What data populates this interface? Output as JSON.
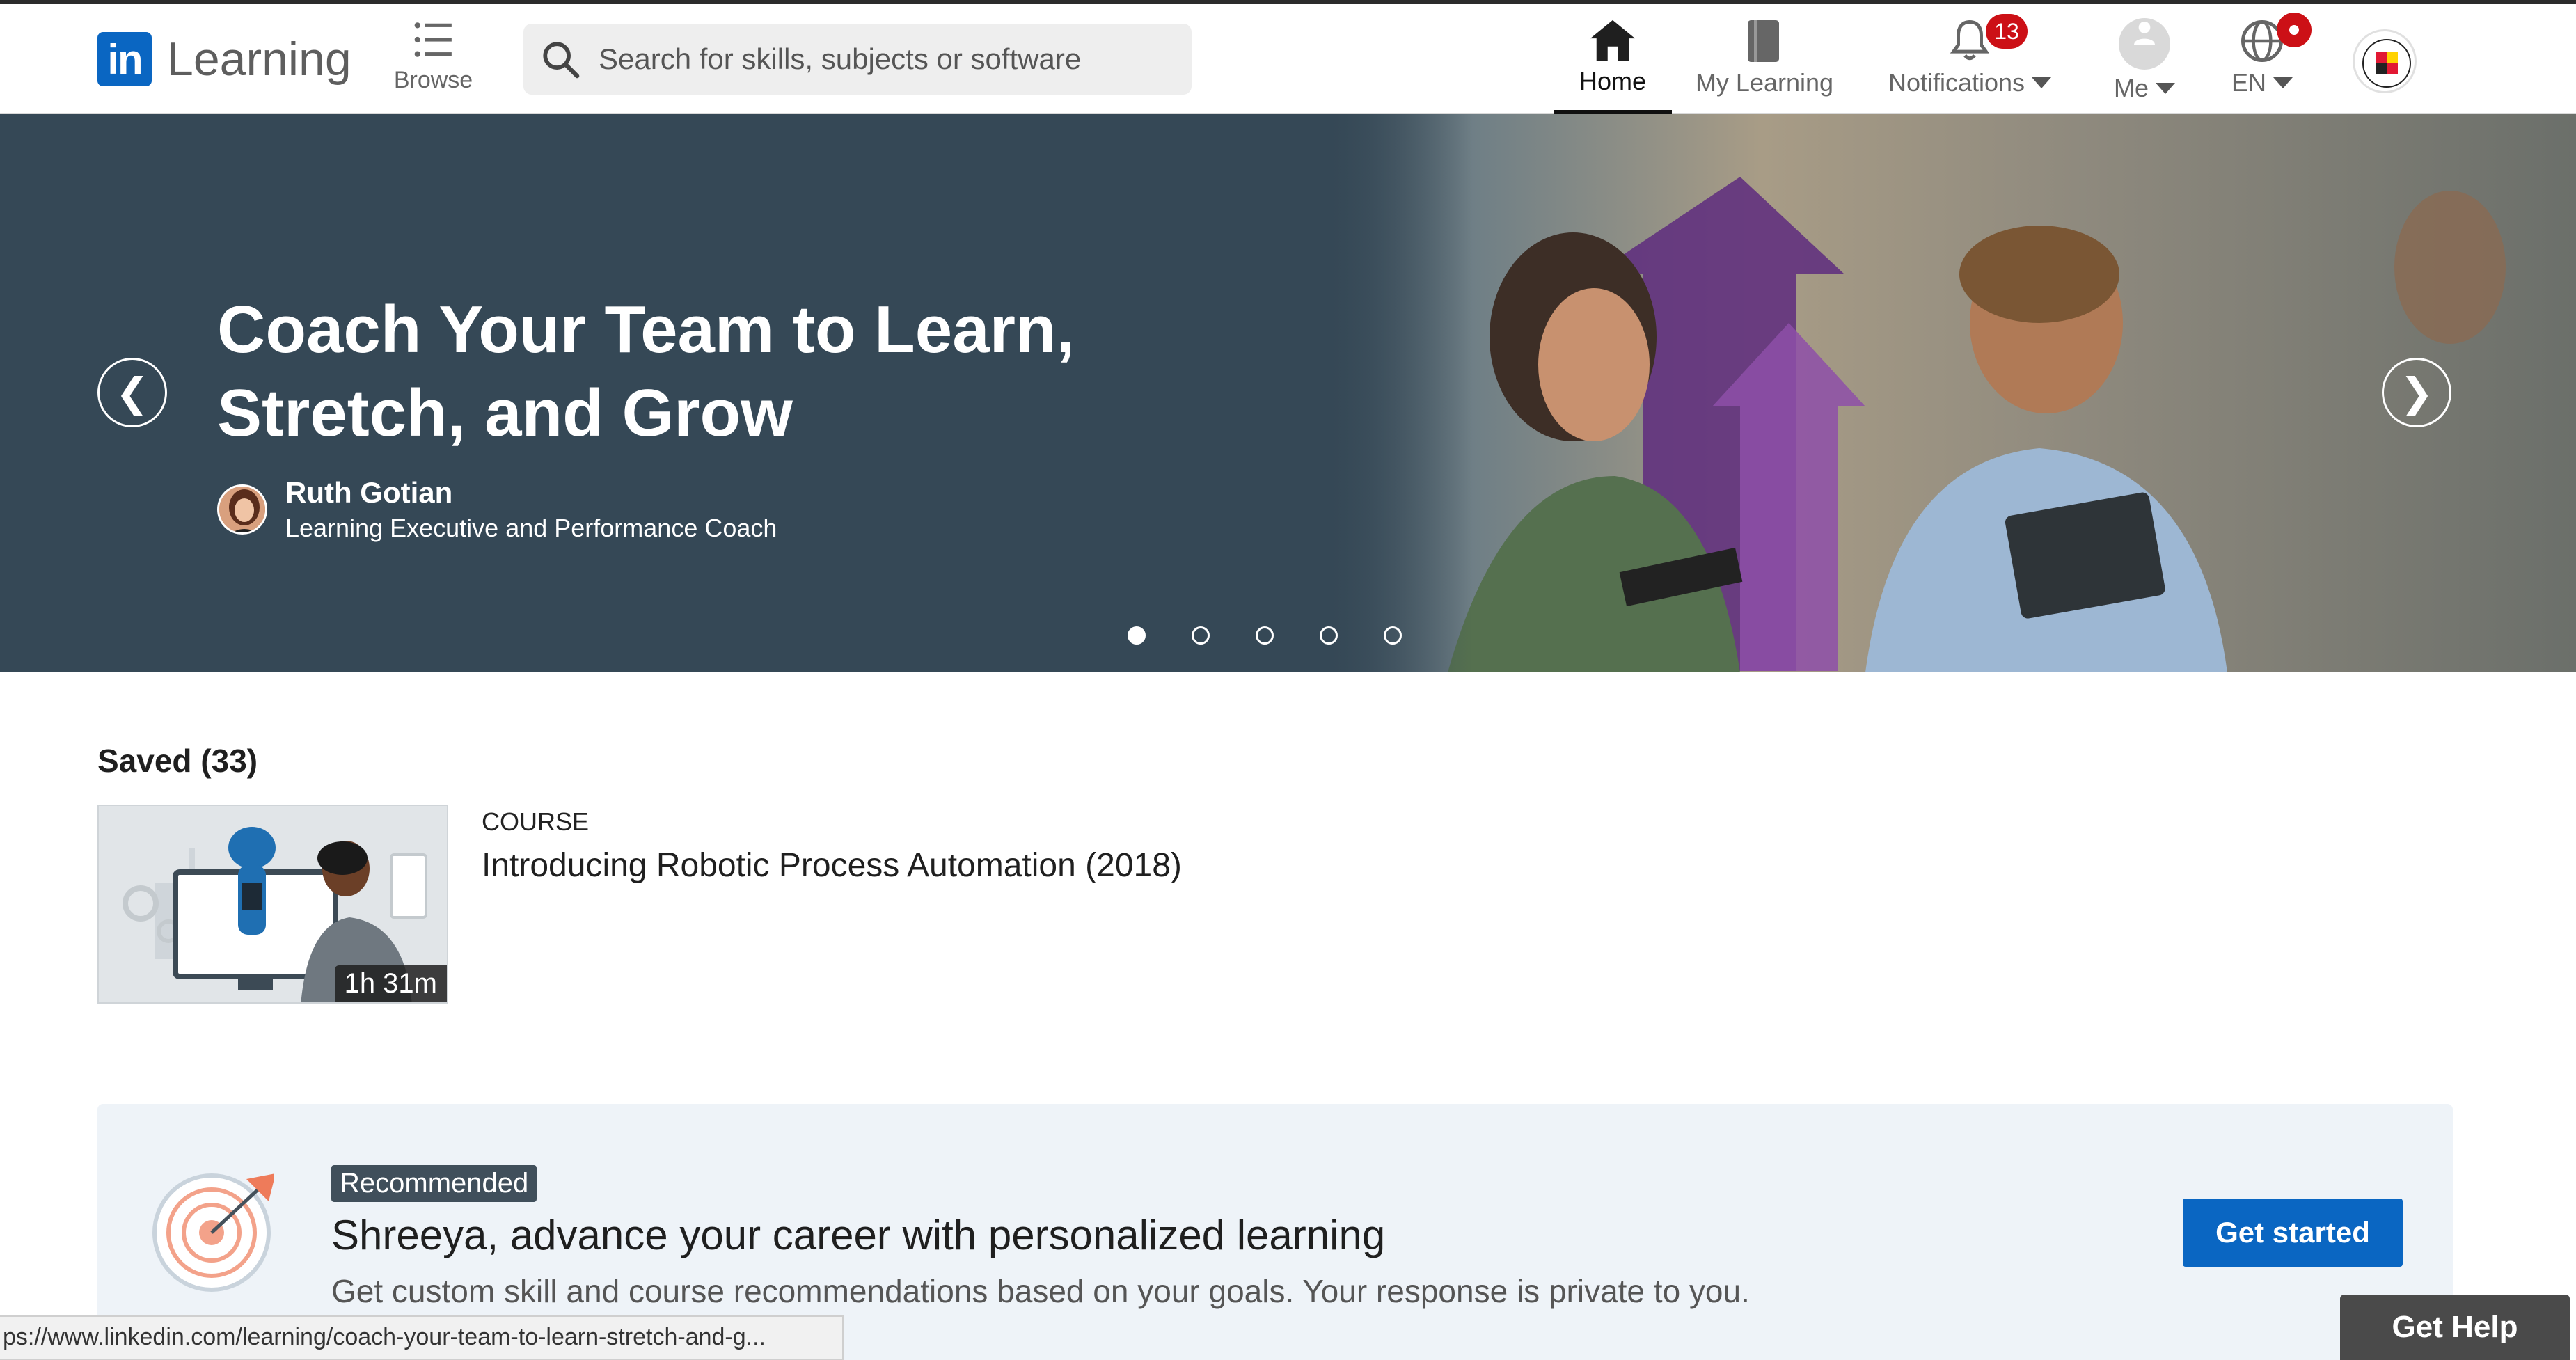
{
  "app": {
    "logo_mark": "in",
    "logo_text": "Learning"
  },
  "nav": {
    "browse_label": "Browse",
    "search_placeholder": "Search for skills, subjects or software",
    "home_label": "Home",
    "my_learning_label": "My Learning",
    "notifications_label": "Notifications",
    "notifications_count": "13",
    "me_label": "Me",
    "language_label": "EN"
  },
  "hero": {
    "title": "Coach Your Team to Learn, Stretch, and Grow",
    "author_name": "Ruth Gotian",
    "author_role": "Learning Executive and Performance Coach",
    "prev_glyph": "❮",
    "next_glyph": "❯",
    "slide_count": 5,
    "active_slide": 1
  },
  "saved": {
    "heading": "Saved (33)",
    "items": [
      {
        "kind": "COURSE",
        "title": "Introducing Robotic Process Automation (2018)",
        "duration": "1h 31m"
      }
    ]
  },
  "recommended": {
    "tag": "Recommended",
    "title": "Shreeya, advance your career with personalized learning",
    "subtitle": "Get custom skill and course recommendations based on your goals. Your response is private to you.",
    "cta": "Get started"
  },
  "status_bar": {
    "url": "ps://www.linkedin.com/learning/coach-your-team-to-learn-stretch-and-g..."
  },
  "help": {
    "label": "Get Help"
  },
  "colors": {
    "brand": "#0a66c2",
    "hero_bg": "#354856",
    "badge": "#cc1016",
    "rec_bg": "#eef3f8"
  },
  "icons": [
    "search-icon",
    "browse-list-icon",
    "home-icon",
    "book-icon",
    "bell-icon",
    "user-icon",
    "globe-icon",
    "university-seal-icon",
    "target-icon"
  ]
}
